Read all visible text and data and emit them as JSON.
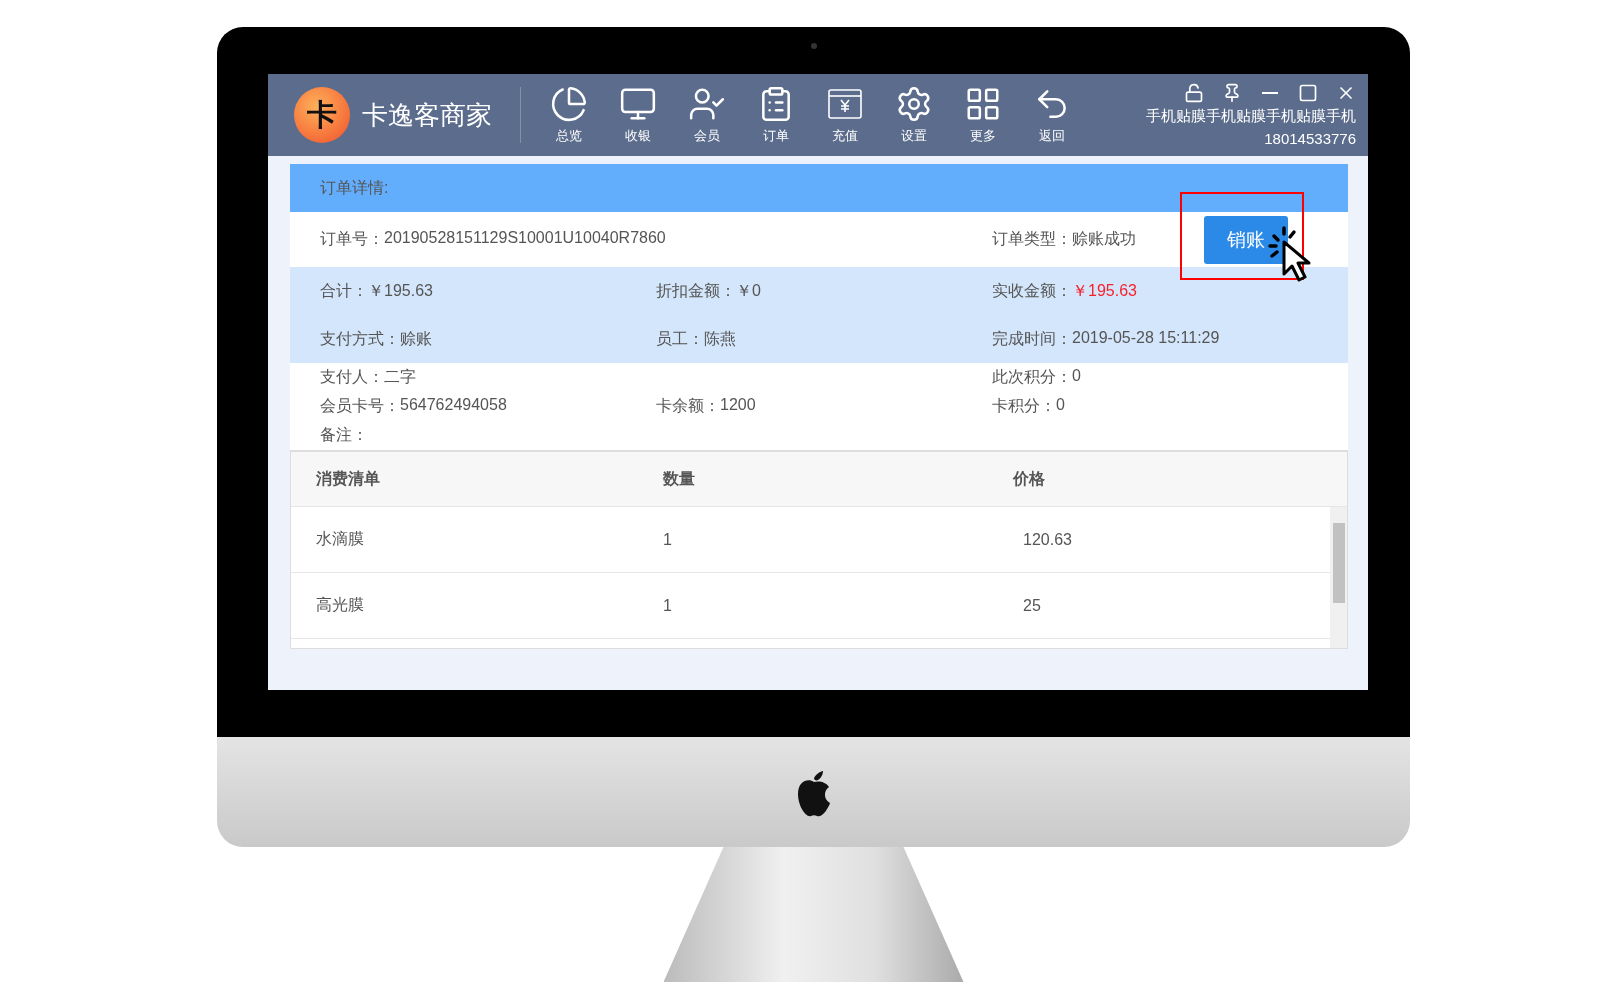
{
  "app": {
    "logo_char": "卡",
    "name": "卡逸客商家"
  },
  "nav": [
    {
      "kind": "overview",
      "label": "总览"
    },
    {
      "kind": "cashier",
      "label": "收银"
    },
    {
      "kind": "member",
      "label": "会员"
    },
    {
      "kind": "order",
      "label": "订单"
    },
    {
      "kind": "recharge",
      "label": "充值"
    },
    {
      "kind": "settings",
      "label": "设置"
    },
    {
      "kind": "more",
      "label": "更多"
    },
    {
      "kind": "back",
      "label": "返回"
    }
  ],
  "shop": {
    "name": "手机贴膜手机贴膜手机贴膜手机",
    "phone": "18014533776"
  },
  "order_detail": {
    "title": "订单详情:",
    "order_no": {
      "label": "订单号：",
      "value": "20190528151129S10001U10040R7860"
    },
    "order_type": {
      "label": "订单类型：",
      "value": "赊账成功"
    },
    "action_button": "销账",
    "summary": [
      [
        {
          "label": "合计：",
          "value": "￥195.63",
          "highlight": false
        },
        {
          "label": "折扣金额：",
          "value": "￥0",
          "highlight": false
        },
        {
          "label": "实收金额：",
          "value": "￥195.63",
          "highlight": true
        }
      ],
      [
        {
          "label": "支付方式：",
          "value": "赊账",
          "highlight": false
        },
        {
          "label": "员工：",
          "value": "陈燕",
          "highlight": false
        },
        {
          "label": "完成时间：",
          "value": "2019-05-28 15:11:29",
          "highlight": false
        }
      ]
    ],
    "extra": {
      "left": [
        {
          "label": "支付人：",
          "value": "二字"
        },
        {
          "label": "会员卡号：",
          "value": "564762494058"
        },
        {
          "label": "备注："
        }
      ],
      "middle": [
        {
          "label": "卡余额：",
          "value": "1200"
        }
      ],
      "right": [
        {
          "label": "此次积分：",
          "value": "0"
        },
        {
          "label": "卡积分：",
          "value": "0"
        }
      ]
    }
  },
  "items_table": {
    "columns": [
      "消费清单",
      "数量",
      "价格"
    ],
    "rows": [
      [
        "水滴膜",
        "1",
        "120.63"
      ],
      [
        "高光膜",
        "1",
        "25"
      ]
    ]
  }
}
